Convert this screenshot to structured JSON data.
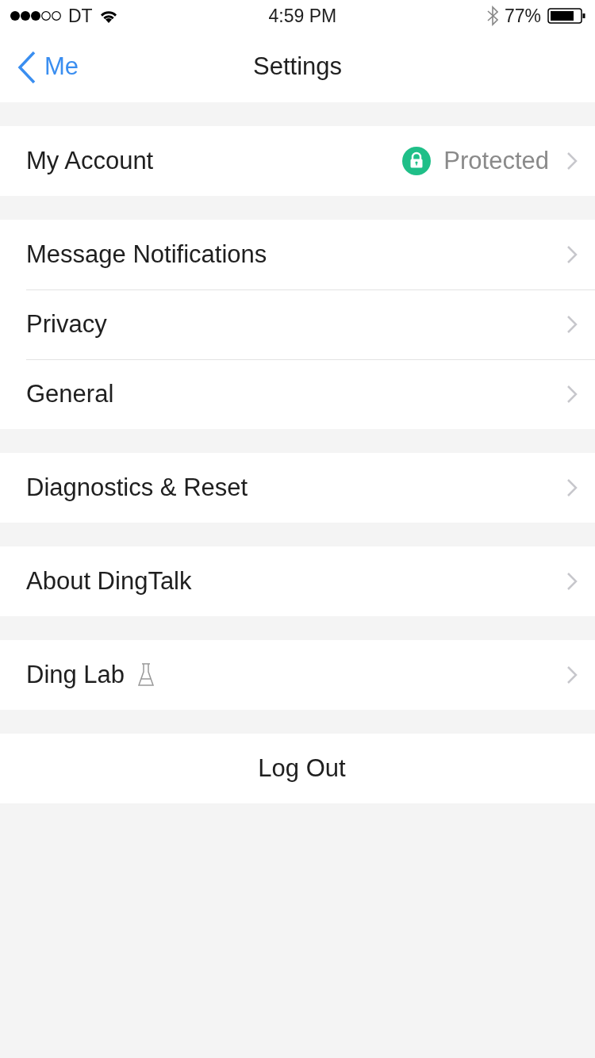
{
  "status_bar": {
    "carrier": "DT",
    "time": "4:59 PM",
    "battery": "77%"
  },
  "nav": {
    "back": "Me",
    "title": "Settings"
  },
  "sections": [
    {
      "rows": [
        {
          "kind": "account",
          "label": "My Account",
          "value": "Protected"
        }
      ]
    },
    {
      "rows": [
        {
          "kind": "plain",
          "label": "Message Notifications"
        },
        {
          "kind": "plain",
          "label": "Privacy"
        },
        {
          "kind": "plain",
          "label": "General"
        }
      ]
    },
    {
      "rows": [
        {
          "kind": "plain",
          "label": "Diagnostics & Reset"
        }
      ]
    },
    {
      "rows": [
        {
          "kind": "plain",
          "label": "About DingTalk"
        }
      ]
    },
    {
      "rows": [
        {
          "kind": "lab",
          "label": "Ding Lab"
        }
      ]
    },
    {
      "rows": [
        {
          "kind": "action",
          "label": "Log Out"
        }
      ]
    }
  ]
}
